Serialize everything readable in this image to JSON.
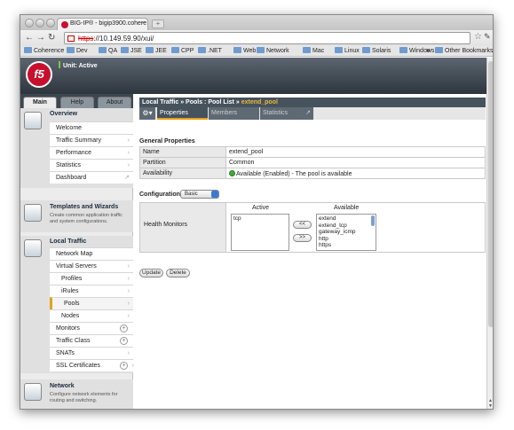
{
  "browser": {
    "tab_title": "BIG-IP® - bigip3900.cohere",
    "url_scheme": "https",
    "url_rest": "://10.149.59.90/xui/",
    "bookmarks": [
      "Coherence",
      "Dev",
      "QA",
      "JSE",
      "JEE",
      "CPP",
      ".NET",
      "Web",
      "Network",
      "Mac",
      "Linux",
      "Solaris",
      "Windows"
    ],
    "overflow": "»",
    "other_bookmarks": "Other Bookmarks"
  },
  "banner": {
    "logo_text": "f5",
    "unit_status": "Unit: Active"
  },
  "nav_tabs": [
    "Main",
    "Help",
    "About"
  ],
  "overview": {
    "title": "Overview",
    "items": [
      "Welcome",
      "Traffic Summary",
      "Performance",
      "Statistics",
      "Dashboard"
    ]
  },
  "templates": {
    "title": "Templates and Wizards",
    "desc": "Create common application traffic and system configurations."
  },
  "local_traffic": {
    "title": "Local Traffic",
    "items": [
      "Network Map",
      "Virtual Servers",
      "Profiles",
      "iRules",
      "Pools",
      "Nodes",
      "Monitors",
      "Traffic Class",
      "SNATs",
      "SSL Certificates"
    ]
  },
  "network": {
    "title": "Network",
    "desc": "Configure network elements for routing and switching."
  },
  "breadcrumb": {
    "a": "Local Traffic",
    "sep": "»",
    "b": "Pools : Pool List",
    "current": "extend_pool"
  },
  "page_tabs": [
    "Properties",
    "Members",
    "Statistics"
  ],
  "general": {
    "title": "General Properties",
    "rows": [
      {
        "label": "Name",
        "value": "extend_pool"
      },
      {
        "label": "Partition",
        "value": "Common"
      },
      {
        "label": "Availability",
        "value": "Available (Enabled) - The pool is available"
      }
    ]
  },
  "configuration": {
    "label": "Configuration:",
    "selected": "Basic"
  },
  "health_monitors": {
    "label": "Health Monitors",
    "active_header": "Active",
    "available_header": "Available",
    "active": [
      "tcp"
    ],
    "available": [
      "extend",
      "extend_tcp",
      "gateway_icmp",
      "http",
      "https"
    ],
    "add_label": "<<",
    "remove_label": ">>"
  },
  "actions": {
    "update": "Update",
    "delete": "Delete"
  },
  "colors": {
    "f5_red": "#c8102e",
    "accent": "#e6a11a",
    "available_green": "#3fae34"
  }
}
